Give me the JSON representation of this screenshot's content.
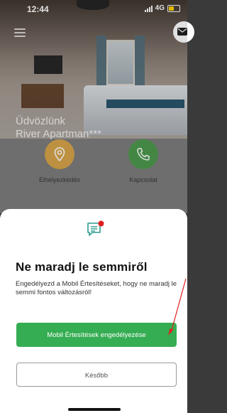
{
  "status_bar": {
    "time": "12:44",
    "network": "4G"
  },
  "hero": {
    "welcome_line1": "Üdvözlünk",
    "welcome_line2": "River Apartman***"
  },
  "actions": [
    {
      "label": "Elhelyezkedés",
      "icon": "location-pin-icon",
      "color": "#d8a64a"
    },
    {
      "label": "Kapcsolat",
      "icon": "phone-icon",
      "color": "#4e9a4e"
    }
  ],
  "sheet": {
    "icon": "notification-chat-icon",
    "title": "Ne maradj le semmiről",
    "description": "Engedélyezd a Mobil Értesítéseket, hogy ne maradj le semmi fontos változásról!",
    "primary_button": "Mobil Értesítések engedélyezése",
    "secondary_button": "Később"
  },
  "colors": {
    "primary_green": "#35ad52",
    "annotation_red": "#e02020",
    "badge_red": "#e02020"
  }
}
